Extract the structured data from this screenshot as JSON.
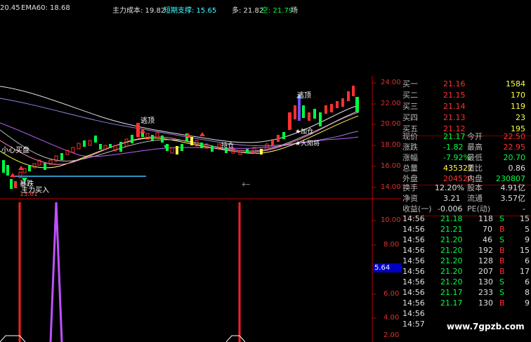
{
  "header": {
    "val1": "20.45",
    "ema60": "EMA60: 18.68",
    "cost": "主力成本: 19.82",
    "support": "短期支撑: 15.65",
    "duo": "多: 21.82",
    "kong": "空: 21.79",
    "tail": "场"
  },
  "price_axis": [
    "24.00",
    "22.00",
    "20.00",
    "18.00",
    "16.00",
    "14.00"
  ],
  "ind_axis": [
    "10.00",
    "8.00",
    "6.00",
    "4.00",
    "2.00"
  ],
  "ind_value": "5.64",
  "annotations": {
    "left_label": "小心买盘",
    "low_arrow": "暴跌",
    "low_buy": "主力买入",
    "low_price": "13.61",
    "mid_top": "逃顶",
    "right_top": "逃顶",
    "mid_note": "持仓",
    "right_n1": "★加仓",
    "right_n2": "★大阳将",
    "cross_marker": "十一"
  },
  "bids": [
    {
      "label": "买一",
      "price": "21.16",
      "vol": "1584"
    },
    {
      "label": "买二",
      "price": "21.15",
      "vol": "170"
    },
    {
      "label": "买三",
      "price": "21.14",
      "vol": "119"
    },
    {
      "label": "买四",
      "price": "21.13",
      "vol": "23"
    },
    {
      "label": "买五",
      "price": "21.12",
      "vol": "195"
    }
  ],
  "quote": [
    {
      "l1": "现价",
      "v1": "21.17",
      "l2": "今开",
      "v2": "22.50"
    },
    {
      "l1": "涨跌",
      "v1": "-1.82",
      "l2": "最高",
      "v2": "22.95"
    },
    {
      "l1": "涨幅",
      "v1": "-7.92%",
      "l2": "最低",
      "v2": "20.70"
    },
    {
      "l1": "总量",
      "v1": "435327",
      "l2": "量比",
      "v2": "0.86"
    },
    {
      "l1": "外盘",
      "v1": "204520",
      "l2": "内盘",
      "v2": "230807"
    }
  ],
  "stats": [
    {
      "l1": "换手",
      "v1": "12.20%",
      "l2": "股本",
      "v2": "4.91亿"
    },
    {
      "l1": "净资",
      "v1": "3.21",
      "l2": "流通",
      "v2": "3.57亿"
    },
    {
      "l1": "收益(一)",
      "v1": "-0.006",
      "l2": "PE(动)",
      "v2": "-"
    }
  ],
  "ticks": [
    {
      "time": "14:56",
      "price": "21.18",
      "vol": "118",
      "bs": "S",
      "n": "15"
    },
    {
      "time": "14:56",
      "price": "21.21",
      "vol": "70",
      "bs": "B",
      "n": "5"
    },
    {
      "time": "14:56",
      "price": "21.20",
      "vol": "46",
      "bs": "S",
      "n": "9"
    },
    {
      "time": "14:56",
      "price": "21.20",
      "vol": "192",
      "bs": "B",
      "n": "15"
    },
    {
      "time": "14:56",
      "price": "21.20",
      "vol": "128",
      "bs": "B",
      "n": "6"
    },
    {
      "time": "14:56",
      "price": "21.20",
      "vol": "207",
      "bs": "B",
      "n": "17"
    },
    {
      "time": "14:56",
      "price": "21.20",
      "vol": "130",
      "bs": "S",
      "n": "6"
    },
    {
      "time": "14:56",
      "price": "21.17",
      "vol": "233",
      "bs": "S",
      "n": "8"
    },
    {
      "time": "14:56",
      "price": "21.17",
      "vol": "130",
      "bs": "B",
      "n": "9"
    },
    {
      "time": "14:56",
      "price": "",
      "vol": "",
      "bs": "",
      "n": ""
    },
    {
      "time": "14:57",
      "price": "",
      "vol": "",
      "bs": "",
      "n": ""
    }
  ],
  "watermark": "www.7gpzb.com",
  "colors": {
    "up": "#ff3030",
    "down": "#00ff40",
    "ma_white": "#e8e8e8",
    "ma_yellow": "#ffff40",
    "ma_purple": "#b070ff",
    "axis_red": "#c00000"
  }
}
